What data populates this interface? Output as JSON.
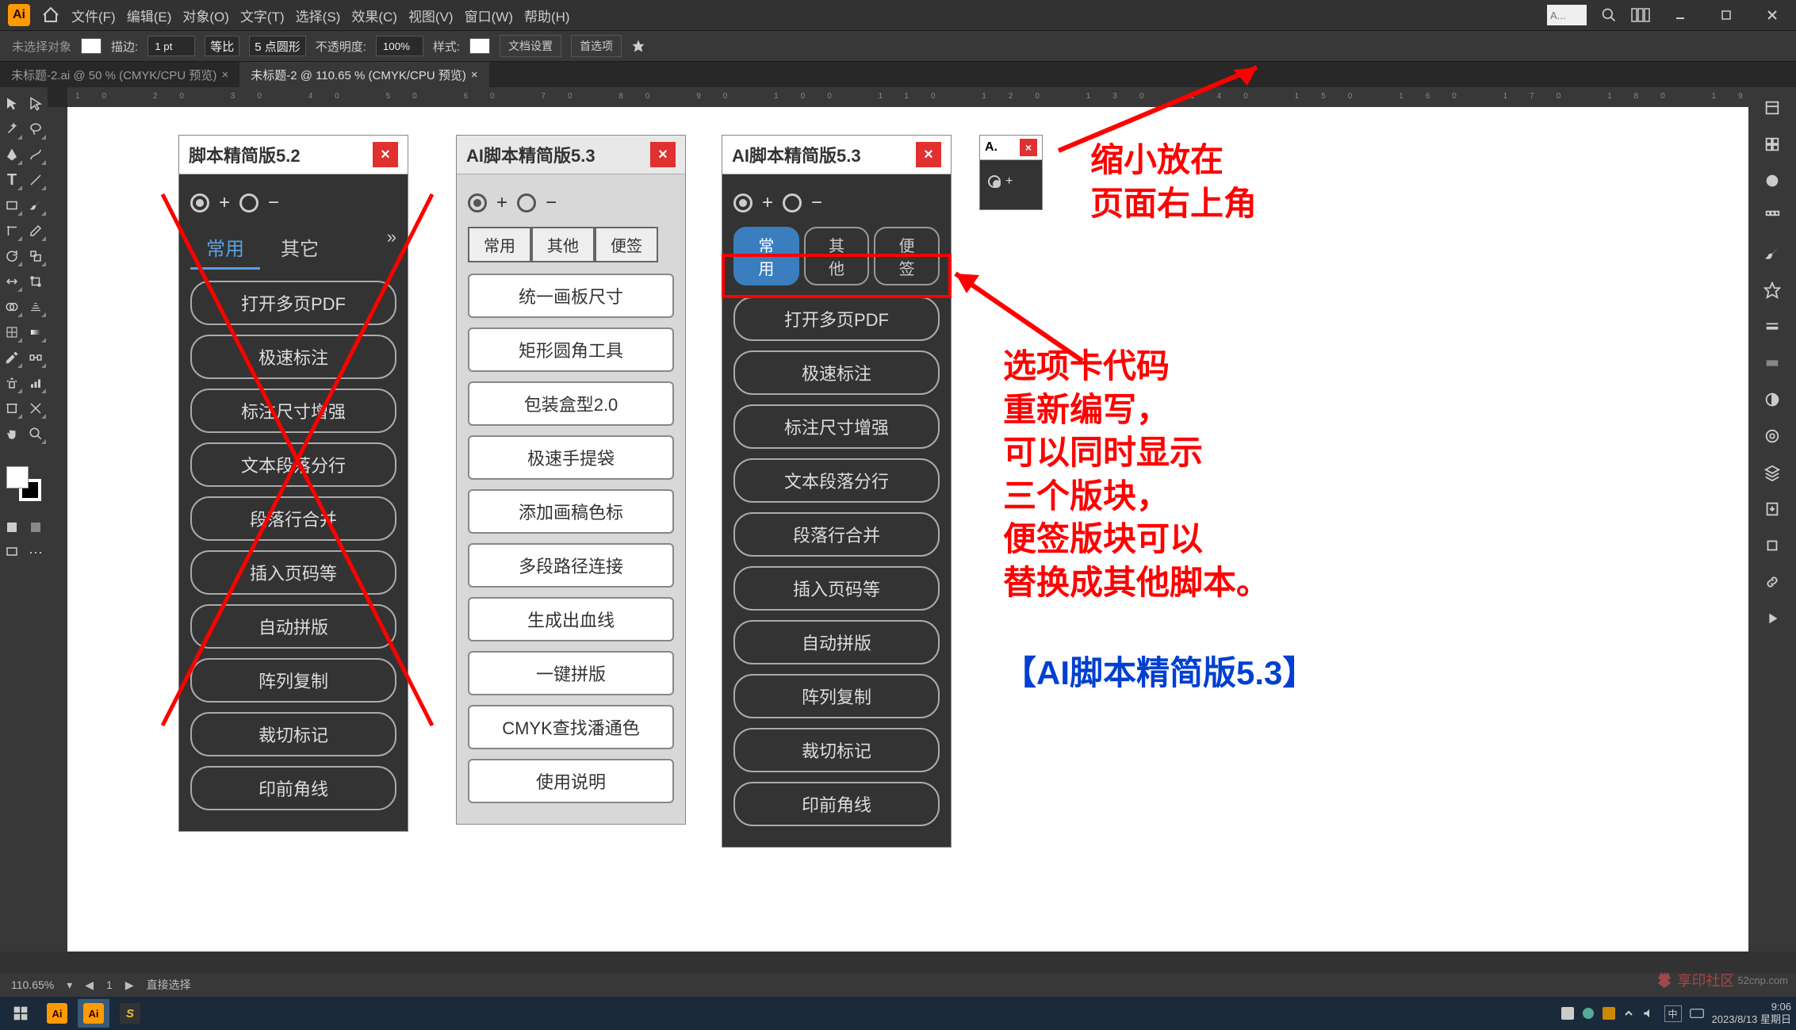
{
  "menubar": {
    "items": [
      "文件(F)",
      "编辑(E)",
      "对象(O)",
      "文字(T)",
      "选择(S)",
      "效果(C)",
      "视图(V)",
      "窗口(W)",
      "帮助(H)"
    ]
  },
  "optionsbar": {
    "noselection": "未选择对象",
    "stroke_label": "描边:",
    "stroke_val": "1 pt",
    "uniform": "等比",
    "brush": "5 点圆形",
    "opacity_label": "不透明度:",
    "opacity_val": "100%",
    "style_label": "样式:",
    "doc_setup": "文档设置",
    "prefs": "首选项"
  },
  "tabs": {
    "t1": "未标题-2.ai @ 50 % (CMYK/CPU 预览)",
    "t2": "未标题-2 @ 110.65 % (CMYK/CPU 预览)"
  },
  "panel52": {
    "title": "脚本精简版5.2",
    "tab1": "常用",
    "tab2": "其它",
    "buttons": [
      "打开多页PDF",
      "极速标注",
      "标注尺寸增强",
      "文本段落分行",
      "段落行合并",
      "插入页码等",
      "自动拼版",
      "阵列复制",
      "裁切标记",
      "印前角线"
    ]
  },
  "panel_light": {
    "title": "AI脚本精简版5.3",
    "tabs": [
      "常用",
      "其他",
      "便签"
    ],
    "buttons": [
      "统一画板尺寸",
      "矩形圆角工具",
      "包装盒型2.0",
      "极速手提袋",
      "添加画稿色标",
      "多段路径连接",
      "生成出血线",
      "一键拼版",
      "CMYK查找潘通色",
      "使用说明"
    ]
  },
  "panel_dark": {
    "title": "AI脚本精简版5.3",
    "tabs": [
      "常用",
      "其他",
      "便签"
    ],
    "buttons": [
      "打开多页PDF",
      "极速标注",
      "标注尺寸增强",
      "文本段落分行",
      "段落行合并",
      "插入页码等",
      "自动拼版",
      "阵列复制",
      "裁切标记",
      "印前角线"
    ]
  },
  "panel_mini": {
    "title": "A."
  },
  "annotations": {
    "text1a": "缩小放在",
    "text1b": "页面右上角",
    "text2a": "选项卡代码",
    "text2b": "重新编写，",
    "text2c": "可以同时显示",
    "text2d": "三个版块，",
    "text2e": "便签版块可以",
    "text2f": "替换成其他脚本。",
    "text3": "【AI脚本精简版5.3】"
  },
  "float_label": "A...",
  "statusbar": {
    "zoom": "110.65%",
    "mode": "直接选择"
  },
  "taskbar": {
    "time": "9:06",
    "date": "2023/8/13 星期日"
  },
  "watermark": "52cnp.com"
}
